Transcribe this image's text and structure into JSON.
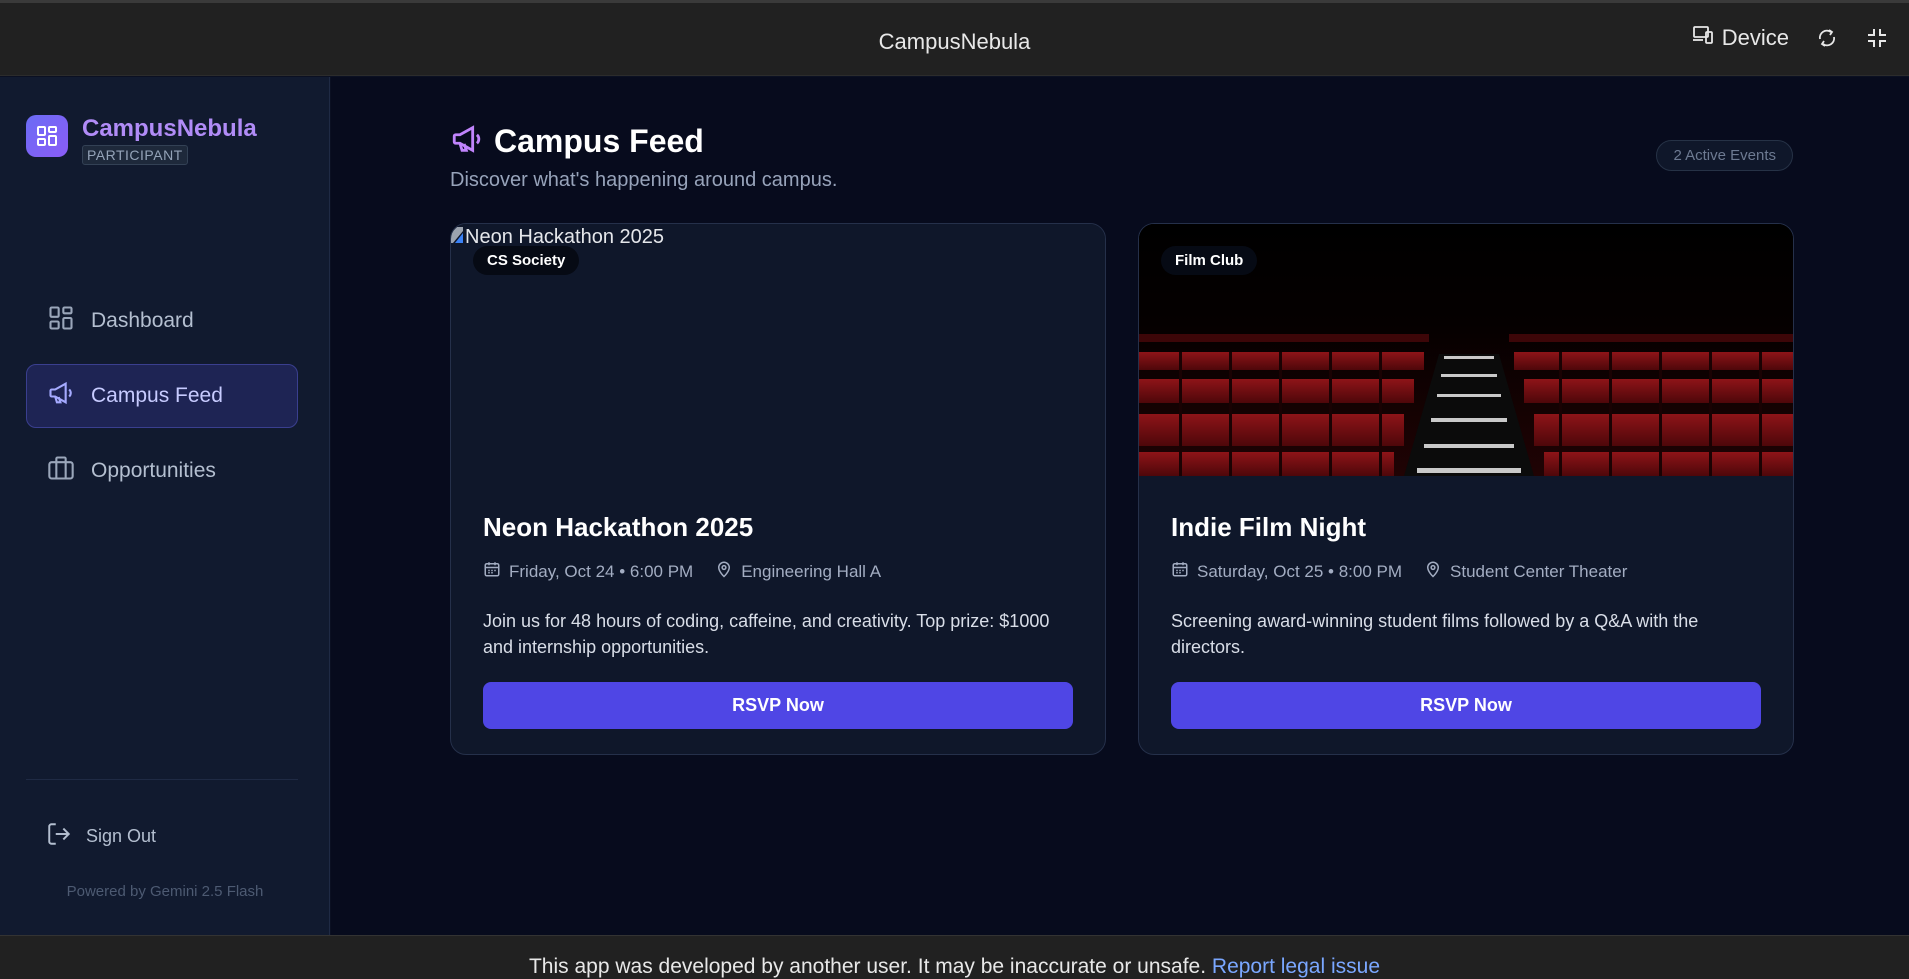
{
  "topbar": {
    "title": "CampusNebula",
    "device_label": "Device",
    "icons": [
      "device-icon",
      "rotate-icon",
      "collapse-icon"
    ]
  },
  "sidebar": {
    "brand": {
      "name": "CampusNebula",
      "role": "PARTICIPANT"
    },
    "items": [
      {
        "label": "Dashboard",
        "icon": "grid-icon",
        "active": false
      },
      {
        "label": "Campus Feed",
        "icon": "megaphone-icon",
        "active": true
      },
      {
        "label": "Opportunities",
        "icon": "briefcase-icon",
        "active": false
      }
    ],
    "sign_out": "Sign Out",
    "powered_by": "Powered by Gemini 2.5 Flash"
  },
  "main": {
    "title": "Campus Feed",
    "subtitle": "Discover what's happening around campus.",
    "badge": "2 Active Events",
    "events": [
      {
        "tag": "CS Society",
        "image_alt": "Neon Hackathon 2025",
        "title": "Neon Hackathon 2025",
        "date": "Friday, Oct 24 • 6:00 PM",
        "location": "Engineering Hall A",
        "description": "Join us for 48 hours of coding, caffeine, and creativity. Top prize: $1000 and internship opportunities.",
        "button": "RSVP Now"
      },
      {
        "tag": "Film Club",
        "title": "Indie Film Night",
        "date": "Saturday, Oct 25 • 8:00 PM",
        "location": "Student Center Theater",
        "description": "Screening award-winning student films followed by a Q&A with the directors.",
        "button": "RSVP Now"
      }
    ]
  },
  "footer": {
    "notice": "This app was developed by another user. It may be inaccurate or unsafe.",
    "link": "Report legal issue"
  },
  "colors": {
    "accent": "#4f46e5",
    "brand": "#b18cf7",
    "megaphone": "#c084fc"
  }
}
